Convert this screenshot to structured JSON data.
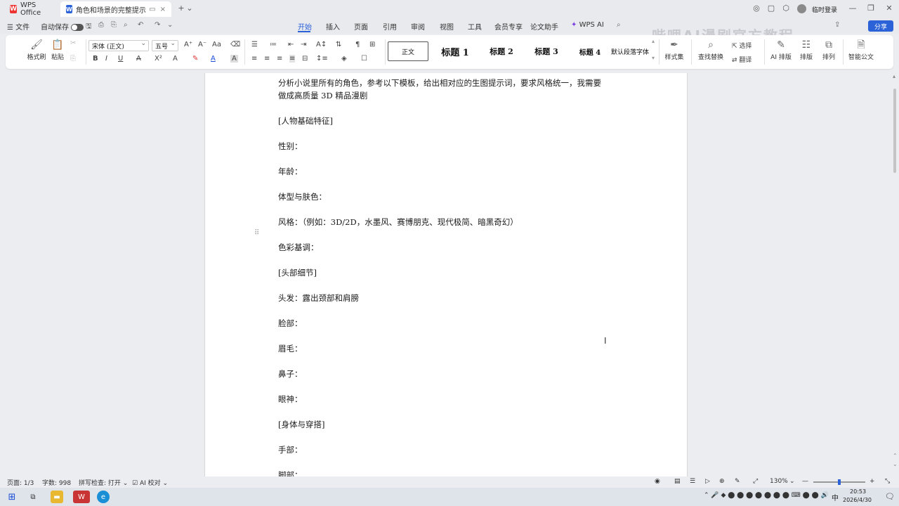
{
  "titlebar": {
    "app_tab": "WPS Office",
    "doc_tab": "角色和场景的完整提示词.docx",
    "login": "临时登录"
  },
  "menu": {
    "file": "文件",
    "autosave": "自动保存",
    "items": [
      "开始",
      "插入",
      "页面",
      "引用",
      "审阅",
      "视图",
      "工具",
      "会员专享",
      "论文助手",
      "WPS AI"
    ],
    "active": "开始",
    "share": "分享"
  },
  "watermark": "哔哩AI漫剧官方教程",
  "ribbon": {
    "format_painter": "格式刷",
    "paste": "粘贴",
    "font_name": "宋体 (正文)",
    "font_size": "五号",
    "styles": [
      "正文",
      "标题 1",
      "标题 2",
      "标题 3",
      "标题 4",
      "默认段落字体"
    ],
    "style_set": "样式集",
    "find_replace": "查找替换",
    "select": "选择",
    "translate": "翻译",
    "ai_layout": "AI 排版",
    "layout": "排版",
    "arrange": "排列",
    "smart_doc": "智能公文"
  },
  "document": {
    "lines": [
      "分析小说里所有的角色，参考以下模板，给出相对应的生图提示词，要求风格统一，我需要",
      "做成高质量 3D 精品漫剧",
      "[人物基础特征]",
      "性别：",
      "年龄：",
      "体型与肤色：",
      "风格：（例如：3D/2D，水墨风、赛博朋克、现代极简、暗黑奇幻）",
      "色彩基调：",
      "[头部细节]",
      "头发：露出颈部和肩膀",
      "脸部：",
      "眉毛：",
      "鼻子：",
      "眼神：",
      "[身体与穿搭]",
      "手部：",
      "脚部："
    ]
  },
  "status": {
    "page": "页面: 1/3",
    "words": "字数: 998",
    "spell": "拼写检查: 打开",
    "ai_check": "AI 校对",
    "zoom": "130%"
  },
  "taskbar": {
    "time": "20:53",
    "date": "2026/4/30",
    "ime": "中"
  },
  "icons": [
    "wps-logo",
    "word-doc-icon",
    "search-icon",
    "close-icon",
    "minimize-icon",
    "maximize-icon",
    "windows-start-icon"
  ]
}
